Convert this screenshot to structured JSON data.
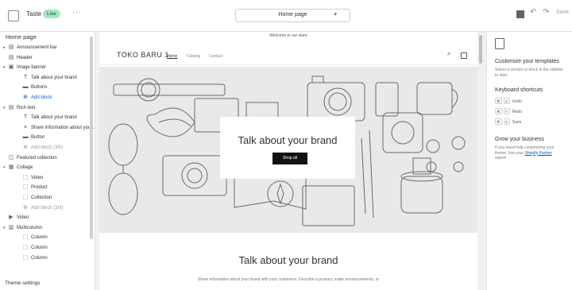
{
  "topbar": {
    "theme_name": "Taste",
    "status_badge": "Live",
    "more": "···",
    "page_select": "Home page",
    "save": "Save"
  },
  "sidebar": {
    "title": "Home page",
    "rows": [
      {
        "name": "announcement-bar",
        "caret": "▸",
        "icon": "▤",
        "label": "Announcement bar",
        "indent": 0,
        "kind": "section"
      },
      {
        "name": "header",
        "caret": "",
        "icon": "▤",
        "label": "Header",
        "indent": 0,
        "kind": "section"
      },
      {
        "name": "image-banner",
        "caret": "▾",
        "icon": "▣",
        "label": "Image banner",
        "indent": 0,
        "kind": "section"
      },
      {
        "name": "image-banner-heading",
        "caret": "",
        "icon": "T",
        "label": "Talk about your brand",
        "indent": 1,
        "kind": "block"
      },
      {
        "name": "image-banner-buttons",
        "caret": "",
        "icon": "▬",
        "label": "Buttons",
        "indent": 1,
        "kind": "block"
      },
      {
        "name": "image-banner-add-block",
        "caret": "",
        "icon": "⊕",
        "label": "Add block",
        "indent": 1,
        "kind": "add"
      },
      {
        "name": "rich-text",
        "caret": "▾",
        "icon": "▤",
        "label": "Rich text",
        "indent": 0,
        "kind": "section"
      },
      {
        "name": "rich-text-heading",
        "caret": "",
        "icon": "T",
        "label": "Talk about your brand",
        "indent": 1,
        "kind": "block"
      },
      {
        "name": "rich-text-text",
        "caret": "",
        "icon": "≡",
        "label": "Share information about your...",
        "indent": 1,
        "kind": "block"
      },
      {
        "name": "rich-text-button",
        "caret": "",
        "icon": "▬",
        "label": "Button",
        "indent": 1,
        "kind": "block"
      },
      {
        "name": "rich-text-add-block",
        "caret": "",
        "icon": "⊕",
        "label": "Add block (3/5)",
        "indent": 1,
        "kind": "dim"
      },
      {
        "name": "featured-collection",
        "caret": "",
        "icon": "◫",
        "label": "Featured collection",
        "indent": 0,
        "kind": "section"
      },
      {
        "name": "collage",
        "caret": "▾",
        "icon": "▦",
        "label": "Collage",
        "indent": 0,
        "kind": "section"
      },
      {
        "name": "collage-video",
        "caret": "",
        "icon": "⬚",
        "label": "Video",
        "indent": 1,
        "kind": "block"
      },
      {
        "name": "collage-product",
        "caret": "",
        "icon": "⬚",
        "label": "Product",
        "indent": 1,
        "kind": "block"
      },
      {
        "name": "collage-collection",
        "caret": "",
        "icon": "⬚",
        "label": "Collection",
        "indent": 1,
        "kind": "block"
      },
      {
        "name": "collage-add-block",
        "caret": "",
        "icon": "⊕",
        "label": "Add block (3/3)",
        "indent": 1,
        "kind": "dim"
      },
      {
        "name": "video",
        "caret": "",
        "icon": "▶",
        "label": "Video",
        "indent": 0,
        "kind": "section"
      },
      {
        "name": "multicolumn",
        "caret": "▾",
        "icon": "▥",
        "label": "Multicolumn",
        "indent": 0,
        "kind": "section"
      },
      {
        "name": "multicolumn-column-1",
        "caret": "",
        "icon": "⬚",
        "label": "Column",
        "indent": 1,
        "kind": "block"
      },
      {
        "name": "multicolumn-column-2",
        "caret": "",
        "icon": "⬚",
        "label": "Column",
        "indent": 1,
        "kind": "block"
      },
      {
        "name": "multicolumn-column-3",
        "caret": "",
        "icon": "⬚",
        "label": "Column",
        "indent": 1,
        "kind": "block"
      }
    ],
    "footer": "Theme settings"
  },
  "preview": {
    "announcement": "Welcome to our store",
    "logo": "TOKO BARU 1",
    "nav": [
      "Home",
      "Catalog",
      "Contact"
    ],
    "hero_title": "Talk about your brand",
    "hero_button": "Shop all",
    "rich_title": "Talk about your brand",
    "rich_text": "Share information about your brand with your customers. Describe a product, make announcements, or"
  },
  "right_panel": {
    "heading": "Customize your templates",
    "intro": "Select a section or block in the sidebar to start.",
    "shortcuts_title": "Keyboard shortcuts",
    "shortcuts": [
      {
        "keys": [
          "⌘",
          "Z"
        ],
        "label": "Undo"
      },
      {
        "keys": [
          "⌘",
          "Y"
        ],
        "label": "Redo"
      },
      {
        "keys": [
          "⌘",
          "S"
        ],
        "label": "Save"
      }
    ],
    "grow_title": "Grow your business",
    "grow_text": "If you need help customizing your theme, hire your",
    "grow_link": "Shopify Partner",
    "grow_suffix": "expert"
  },
  "colors": {
    "accent": "#005bd3",
    "badge_bg": "#a5e8bf",
    "button_bg": "#121212"
  }
}
